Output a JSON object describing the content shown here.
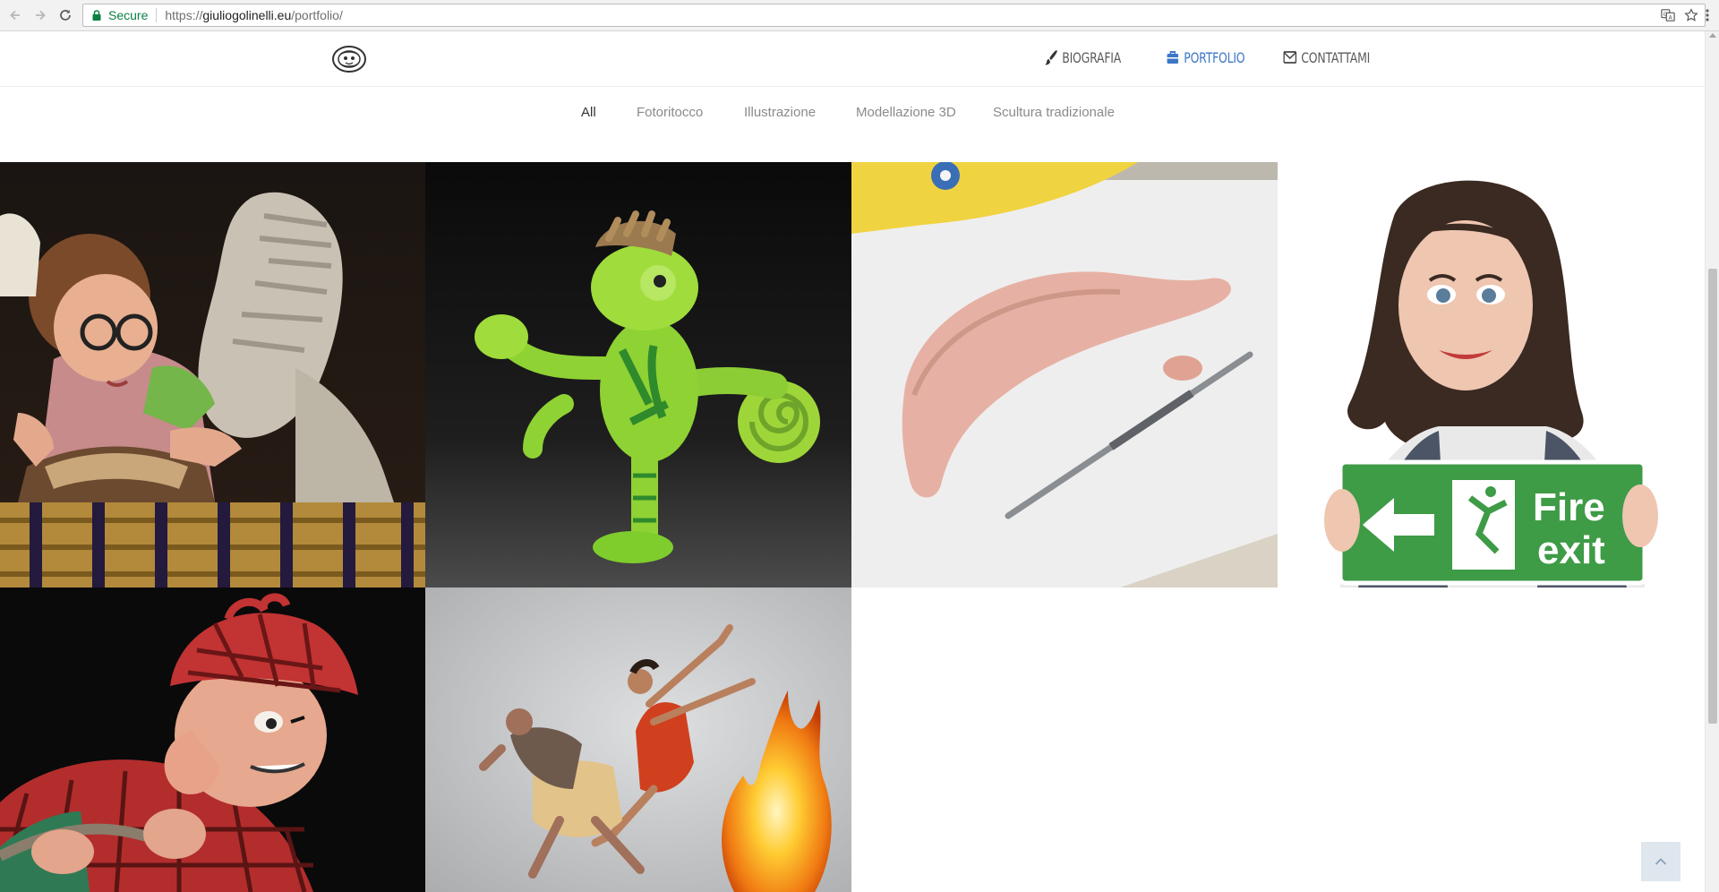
{
  "browser": {
    "secure_label": "Secure",
    "url_scheme": "https://",
    "url_host": "giuliogolinelli.eu",
    "url_path": "/portfolio/",
    "icons": [
      "back-arrow-icon",
      "forward-arrow-icon",
      "reload-icon",
      "lock-icon",
      "translate-icon",
      "star-icon",
      "menu-dots-icon"
    ]
  },
  "header": {
    "logo": "site-logo",
    "nav": [
      {
        "label": "BIOGRAFIA",
        "icon": "paintbrush-icon",
        "active": false
      },
      {
        "label": "PORTFOLIO",
        "icon": "briefcase-icon",
        "active": true
      },
      {
        "label": "CONTATTAMI",
        "icon": "envelope-icon",
        "active": false
      }
    ],
    "active_color": "#3d76c7"
  },
  "filters": [
    {
      "label": "All",
      "active": true
    },
    {
      "label": "Fotoritocco",
      "active": false
    },
    {
      "label": "Illustrazione",
      "active": false
    },
    {
      "label": "Modellazione 3D",
      "active": false
    },
    {
      "label": "Scultura tradizionale",
      "active": false
    }
  ],
  "portfolio": {
    "items": [
      {
        "name": "old-woman-and-mummy-sculpture"
      },
      {
        "name": "green-chameleon-3d-model"
      },
      {
        "name": "clay-banana-sculpture"
      },
      {
        "name": "fire-exit-woman-figure"
      },
      {
        "name": "tartan-detective-sculpture"
      },
      {
        "name": "dancers-and-fire-photo"
      }
    ]
  },
  "back_to_top_icon": "chevron-up-icon"
}
